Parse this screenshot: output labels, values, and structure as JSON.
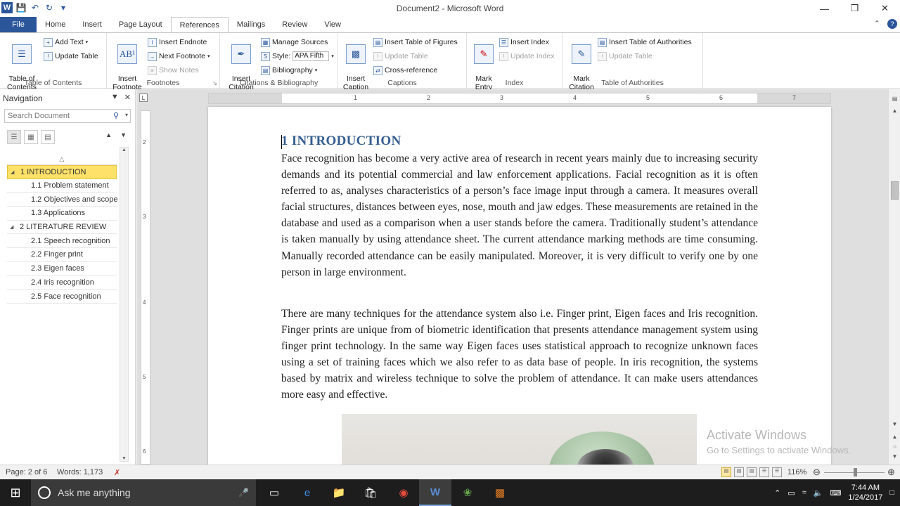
{
  "window": {
    "title": "Document2 - Microsoft Word"
  },
  "tabs": [
    "File",
    "Home",
    "Insert",
    "Page Layout",
    "References",
    "Mailings",
    "Review",
    "View"
  ],
  "active_tab": "References",
  "ribbon": {
    "toc": {
      "table_of_contents": "Table of\nContents",
      "add_text": "Add Text",
      "update_table": "Update Table",
      "label": "Table of Contents"
    },
    "footnotes": {
      "insert_footnote": "Insert\nFootnote",
      "insert_endnote": "Insert Endnote",
      "next_footnote": "Next Footnote",
      "show_notes": "Show Notes",
      "label": "Footnotes"
    },
    "citations": {
      "insert_citation": "Insert\nCitation",
      "manage_sources": "Manage Sources",
      "style_label": "Style:",
      "style_value": "APA Fifth",
      "bibliography": "Bibliography",
      "label": "Citations & Bibliography"
    },
    "captions": {
      "insert_caption": "Insert\nCaption",
      "insert_table_of_figures": "Insert Table of Figures",
      "update_table": "Update Table",
      "cross_reference": "Cross-reference",
      "label": "Captions"
    },
    "index": {
      "mark_entry": "Mark\nEntry",
      "insert_index": "Insert Index",
      "update_index": "Update Index",
      "label": "Index"
    },
    "authorities": {
      "mark_citation": "Mark\nCitation",
      "insert_table_of_authorities": "Insert Table of Authorities",
      "update_table": "Update Table",
      "label": "Table of Authorities"
    }
  },
  "navigation": {
    "title": "Navigation",
    "search_placeholder": "Search Document",
    "headings": [
      {
        "text": "1 INTRODUCTION",
        "level": 1,
        "selected": true
      },
      {
        "text": "1.1 Problem statement",
        "level": 2
      },
      {
        "text": "1.2 Objectives and scope",
        "level": 2
      },
      {
        "text": "1.3 Applications",
        "level": 2
      },
      {
        "text": "2 LITERATURE REVIEW",
        "level": 1
      },
      {
        "text": "2.1 Speech recognition",
        "level": 2
      },
      {
        "text": "2.2 Finger print",
        "level": 2
      },
      {
        "text": "2.3 Eigen faces",
        "level": 2
      },
      {
        "text": "2.4 Iris recognition",
        "level": 2
      },
      {
        "text": "2.5 Face recognition",
        "level": 2
      }
    ]
  },
  "document": {
    "heading": "1 INTRODUCTION",
    "paragraph1": "Face recognition has become a very active area of research in recent years mainly due to increasing security demands and its potential commercial and law enforcement applications. Facial recognition as it is often referred to as, analyses characteristics of a person’s face image input through a camera. It measures overall facial structures, distances between eyes, nose, mouth and jaw edges. These measurements are retained in the database and used as a comparison when a user stands before the camera. Traditionally student’s attendance is taken manually by using attendance sheet. The current attendance marking methods are time consuming. Manually recorded attendance can be easily manipulated. Moreover, it is very difficult to verify one by one person in large environment.",
    "paragraph2": "There are many techniques for the attendance system also i.e. Finger print, Eigen faces and Iris recognition. Finger prints are unique from of biometric identification that presents attendance management system using finger print technology. In the same way Eigen faces uses statistical approach to recognize unknown faces using a set of training faces which we also refer to as data base of people. In iris recognition, the systems based by matrix and wireless technique to solve the problem of attendance. It can make users attendances more easy and effective."
  },
  "ruler_numbers": [
    "1",
    "2",
    "3",
    "4",
    "5",
    "6",
    "7"
  ],
  "watermark": {
    "line1": "Activate Windows",
    "line2": "Go to Settings to activate Windows."
  },
  "status": {
    "page": "Page: 2 of 6",
    "words": "Words: 1,173",
    "zoom": "116%"
  },
  "taskbar": {
    "search_placeholder": "Ask me anything",
    "time": "7:44 AM",
    "date": "1/24/2017"
  },
  "colors": {
    "accent": "#2b579a",
    "heading": "#365f91",
    "nav_selected": "#fde168"
  }
}
